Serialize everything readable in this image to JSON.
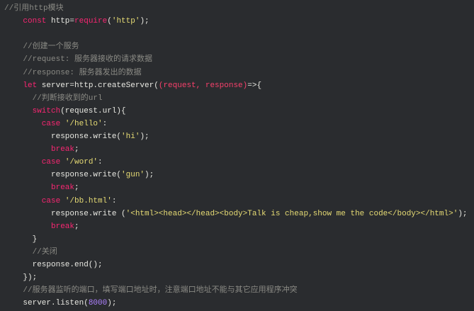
{
  "colors": {
    "background": "#2a2c2f",
    "keyword": "#f92672",
    "string": "#e6db74",
    "comment": "#8a8a84",
    "number": "#ae81ff",
    "param": "#f7406b",
    "text": "#e8e8e2"
  },
  "code_lines": [
    {
      "indent": 0,
      "tokens": [
        [
          "cm",
          "//引用http模块"
        ]
      ]
    },
    {
      "indent": 4,
      "tokens": [
        [
          "kw",
          "const"
        ],
        [
          "plain",
          " http="
        ],
        [
          "kw",
          "require"
        ],
        [
          "plain",
          "("
        ],
        [
          "str",
          "'http'"
        ],
        [
          "plain",
          ");"
        ]
      ]
    },
    {
      "indent": 0,
      "tokens": []
    },
    {
      "indent": 4,
      "tokens": [
        [
          "cm",
          "//创建一个服务"
        ]
      ]
    },
    {
      "indent": 4,
      "tokens": [
        [
          "cm",
          "//request: 服务器接收的请求数据"
        ]
      ]
    },
    {
      "indent": 4,
      "tokens": [
        [
          "cm",
          "//response: 服务器发出的数据"
        ]
      ]
    },
    {
      "indent": 4,
      "tokens": [
        [
          "kw",
          "let"
        ],
        [
          "plain",
          " server=http.createServer("
        ],
        [
          "param",
          "(request, response)"
        ],
        [
          "plain",
          "=>{"
        ]
      ]
    },
    {
      "indent": 6,
      "tokens": [
        [
          "cm",
          "//判断接收到的url"
        ]
      ]
    },
    {
      "indent": 6,
      "tokens": [
        [
          "kw",
          "switch"
        ],
        [
          "plain",
          "(request.url){"
        ]
      ]
    },
    {
      "indent": 8,
      "tokens": [
        [
          "kw",
          "case"
        ],
        [
          "plain",
          " "
        ],
        [
          "str",
          "'/hello'"
        ],
        [
          "plain",
          ":"
        ]
      ]
    },
    {
      "indent": 10,
      "tokens": [
        [
          "plain",
          "response.write("
        ],
        [
          "str",
          "'hi'"
        ],
        [
          "plain",
          ");"
        ]
      ]
    },
    {
      "indent": 10,
      "tokens": [
        [
          "kw",
          "break"
        ],
        [
          "plain",
          ";"
        ]
      ]
    },
    {
      "indent": 8,
      "tokens": [
        [
          "kw",
          "case"
        ],
        [
          "plain",
          " "
        ],
        [
          "str",
          "'/word'"
        ],
        [
          "plain",
          ":"
        ]
      ]
    },
    {
      "indent": 10,
      "tokens": [
        [
          "plain",
          "response.write("
        ],
        [
          "str",
          "'gun'"
        ],
        [
          "plain",
          ");"
        ]
      ]
    },
    {
      "indent": 10,
      "tokens": [
        [
          "kw",
          "break"
        ],
        [
          "plain",
          ";"
        ]
      ]
    },
    {
      "indent": 8,
      "tokens": [
        [
          "kw",
          "case"
        ],
        [
          "plain",
          " "
        ],
        [
          "str",
          "'/bb.html'"
        ],
        [
          "plain",
          ":"
        ]
      ]
    },
    {
      "indent": 10,
      "tokens": [
        [
          "plain",
          "response.write ("
        ],
        [
          "str",
          "'<html><head></head><body>Talk is cheap,show me the code</body></html>'"
        ],
        [
          "plain",
          ");"
        ]
      ]
    },
    {
      "indent": 10,
      "tokens": [
        [
          "kw",
          "break"
        ],
        [
          "plain",
          ";"
        ]
      ]
    },
    {
      "indent": 6,
      "tokens": [
        [
          "plain",
          "}"
        ]
      ]
    },
    {
      "indent": 6,
      "tokens": [
        [
          "cm",
          "//关闭"
        ]
      ]
    },
    {
      "indent": 6,
      "tokens": [
        [
          "plain",
          "response.end();"
        ]
      ]
    },
    {
      "indent": 4,
      "tokens": [
        [
          "plain",
          "});"
        ]
      ]
    },
    {
      "indent": 4,
      "tokens": [
        [
          "cm",
          "//服务器监听的端口，填写端口地址时，注意端口地址不能与其它应用程序冲突"
        ]
      ]
    },
    {
      "indent": 4,
      "tokens": [
        [
          "plain",
          "server.listen("
        ],
        [
          "num",
          "8000"
        ],
        [
          "plain",
          ");"
        ]
      ]
    }
  ]
}
